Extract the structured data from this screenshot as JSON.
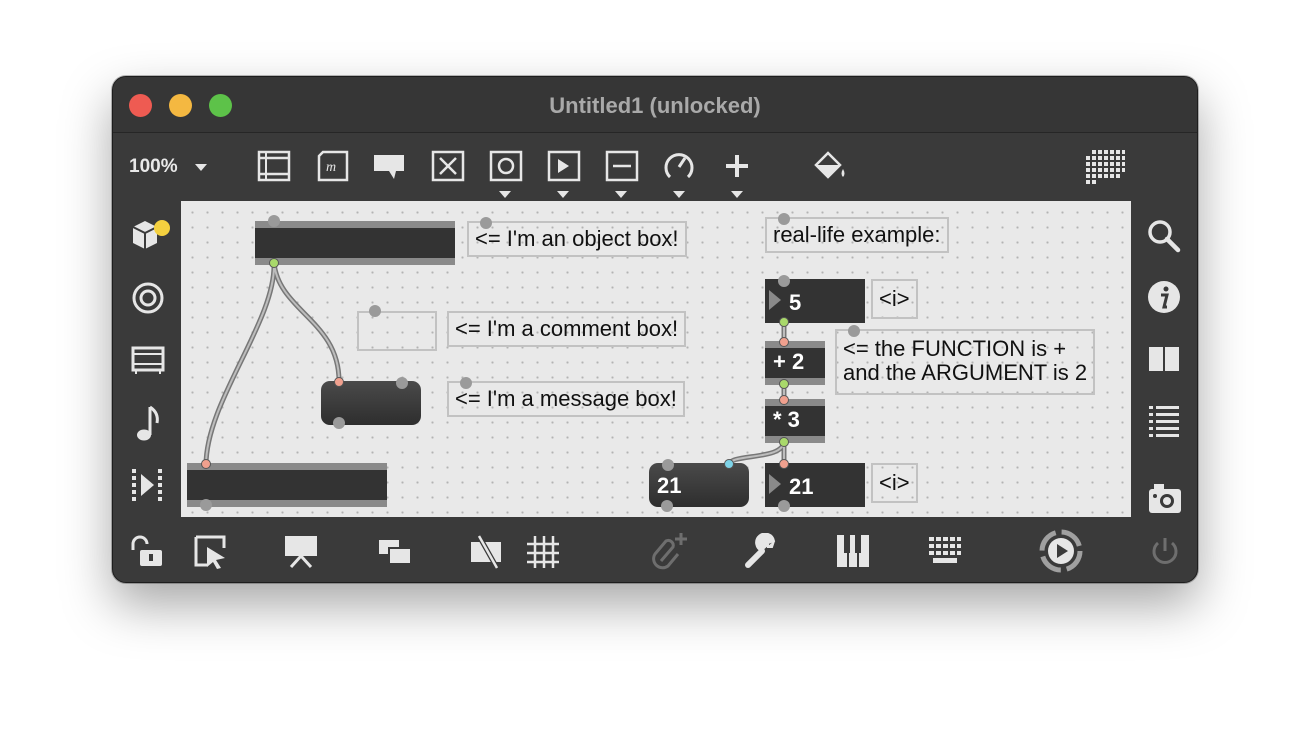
{
  "window": {
    "title": "Untitled1 (unlocked)"
  },
  "toolbar": {
    "zoom": "100%",
    "icons": [
      "object-box-icon",
      "message-box-icon",
      "comment-icon",
      "toggle-icon",
      "button-icon",
      "playbar-icon",
      "slider-icon",
      "dial-icon",
      "add-icon",
      "paint-bucket-icon",
      "grid-menu-icon"
    ]
  },
  "left_sidebar": {
    "icons": [
      "packages-icon",
      "target-icon",
      "presentation-icon",
      "music-note-icon",
      "debug-step-icon"
    ]
  },
  "right_sidebar": {
    "icons": [
      "search-icon",
      "info-icon",
      "reference-icon",
      "list-icon",
      "snapshot-icon"
    ]
  },
  "bottombar": {
    "icons": [
      "lock-icon",
      "select-arrow-icon",
      "presentation-mode-icon",
      "layers-icon",
      "no-patch-cords-icon",
      "grid-icon",
      "attach-icon",
      "wrench-icon",
      "piano-keys-icon",
      "keyboard-icon",
      "play-icon",
      "power-icon"
    ]
  },
  "patch": {
    "comments": {
      "object": "<= I'm an object box!",
      "comment": "<= I'm a comment box!",
      "message": "<= I'm a message box!",
      "example": "real-life example:",
      "function_line1": "<= the FUNCTION is +",
      "function_line2": "and the ARGUMENT is 2",
      "i_top": "<i>",
      "i_bottom": "<i>"
    },
    "objects": {
      "plus": "+ 2",
      "times": "* 3"
    },
    "numbers": {
      "top": "5",
      "bottom": "21"
    },
    "messages": {
      "result": "21"
    }
  },
  "colors": {
    "close": "#ee5b52",
    "minimize": "#f4b841",
    "maximize": "#5dc249",
    "canvas": "#e9e9e9",
    "box_dark": "#333333",
    "box_border": "#8a8a8a",
    "inlet": "#f0a08e",
    "outlet_green": "#a9d96b",
    "outlet_blue": "#7dd3e8",
    "badge_yellow": "#f4d03f"
  }
}
